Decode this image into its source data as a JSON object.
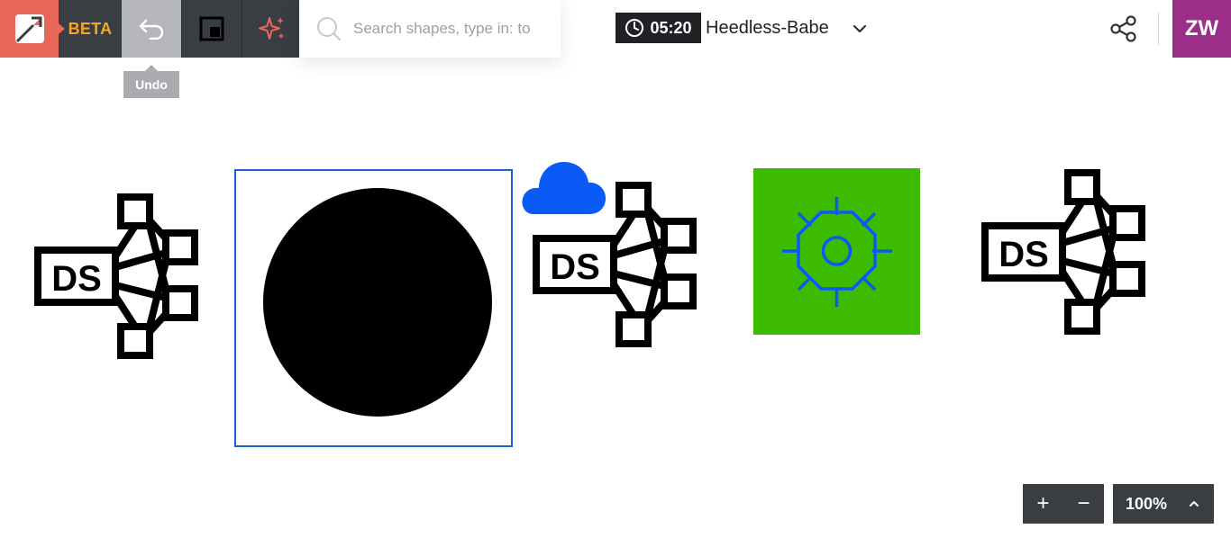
{
  "toolbar": {
    "logo_icon": "app-logo-icon",
    "beta_label": "BETA",
    "undo_icon": "undo-arrow-icon",
    "layout_icon": "layout-squares-icon",
    "ai_icon": "sparkle-icon",
    "undo_tooltip": "Undo"
  },
  "search": {
    "icon": "search-icon",
    "placeholder": "Search shapes, type in: to",
    "value": ""
  },
  "header": {
    "timer": "05:20",
    "timer_icon": "clock-icon",
    "doc_name": "Heedless-Babe",
    "doc_dropdown_icon": "chevron-down-icon",
    "share_icon": "share-icon",
    "avatar_initials": "ZW"
  },
  "canvas": {
    "shapes": [
      {
        "name": "ds-network-shape-1",
        "label": "DS"
      },
      {
        "name": "black-circle-shape"
      },
      {
        "name": "cloud-shape",
        "color": "#0a5af5"
      },
      {
        "name": "ds-network-shape-2",
        "label": "DS"
      },
      {
        "name": "green-square-wheel-shape",
        "fill": "#3dbb00",
        "stroke": "#0a5af5"
      },
      {
        "name": "ds-network-shape-3",
        "label": "DS"
      }
    ],
    "selection_color": "#1f5fd6"
  },
  "zoom": {
    "plus_label": "+",
    "minus_label": "−",
    "level": "100%",
    "level_dropdown_icon": "chevron-up-icon"
  },
  "colors": {
    "toolbar_dark": "#3a3d42",
    "logo_bg": "#e8675a",
    "beta": "#f5a623",
    "avatar_bg": "#9a2e88"
  }
}
